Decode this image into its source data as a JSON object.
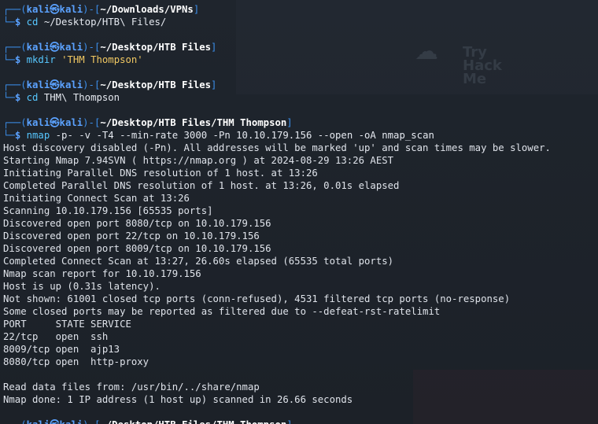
{
  "prompt_user": "kali",
  "prompt_at": "㉿",
  "prompt_host": "kali",
  "blocks": [
    {
      "cwd": "~/Downloads/VPNs",
      "cmd": "cd",
      "args": " ~/Desktop/HTB\\ Files/",
      "str": ""
    },
    {
      "cwd": "~/Desktop/HTB Files",
      "cmd": "mkdir",
      "args": " ",
      "str": "'THM Thompson'"
    },
    {
      "cwd": "~/Desktop/HTB Files",
      "cmd": "cd",
      "args": " THM\\ Thompson",
      "str": ""
    },
    {
      "cwd": "~/Desktop/HTB Files/THM Thompson",
      "cmd": "nmap",
      "args": " -p- -v -T4 --min-rate 3000 -Pn 10.10.179.156 --open -oA nmap_scan",
      "str": ""
    }
  ],
  "output": [
    "Host discovery disabled (-Pn). All addresses will be marked 'up' and scan times may be slower.",
    "Starting Nmap 7.94SVN ( https://nmap.org ) at 2024-08-29 13:26 AEST",
    "Initiating Parallel DNS resolution of 1 host. at 13:26",
    "Completed Parallel DNS resolution of 1 host. at 13:26, 0.01s elapsed",
    "Initiating Connect Scan at 13:26",
    "Scanning 10.10.179.156 [65535 ports]",
    "Discovered open port 8080/tcp on 10.10.179.156",
    "Discovered open port 22/tcp on 10.10.179.156",
    "Discovered open port 8009/tcp on 10.10.179.156",
    "Completed Connect Scan at 13:27, 26.60s elapsed (65535 total ports)",
    "Nmap scan report for 10.10.179.156",
    "Host is up (0.31s latency).",
    "Not shown: 61001 closed tcp ports (conn-refused), 4531 filtered tcp ports (no-response)",
    "Some closed ports may be reported as filtered due to --defeat-rst-ratelimit",
    "PORT     STATE SERVICE",
    "22/tcp   open  ssh",
    "8009/tcp open  ajp13",
    "8080/tcp open  http-proxy",
    "",
    "Read data files from: /usr/bin/../share/nmap",
    "Nmap done: 1 IP address (1 host up) scanned in 26.66 seconds"
  ],
  "last_prompt_cwd": "~/Desktop/HTB Files/THM Thompson",
  "colors": {
    "prompt": "#3b8eea",
    "command": "#57c7ff",
    "string": "#f1c862",
    "text": "#dfe3ea"
  }
}
